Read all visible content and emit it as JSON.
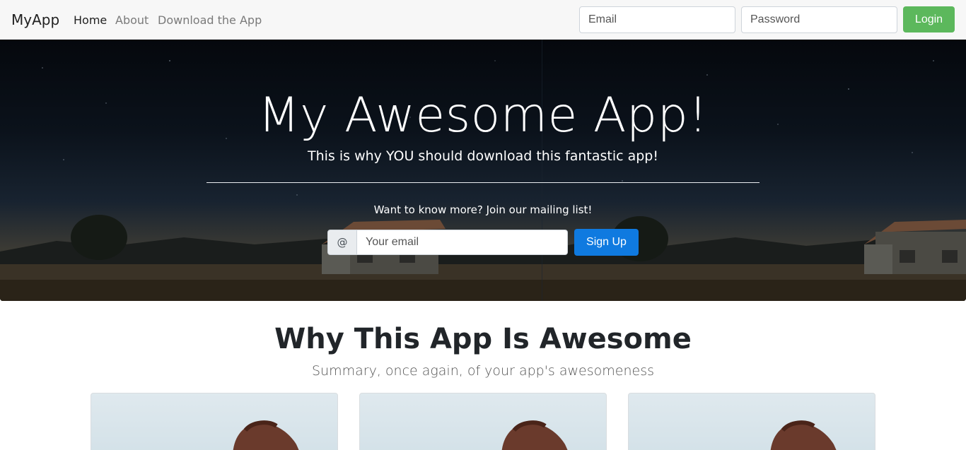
{
  "nav": {
    "brand": "MyApp",
    "links": [
      {
        "label": "Home",
        "active": true
      },
      {
        "label": "About",
        "active": false
      },
      {
        "label": "Download the App",
        "active": false
      }
    ],
    "email_placeholder": "Email",
    "password_placeholder": "Password",
    "login_label": "Login"
  },
  "hero": {
    "title": "My Awesome App!",
    "subtitle": "This is why YOU should download this fantastic app!",
    "mailing_text": "Want to know more? Join our mailing list!",
    "addon": "@",
    "email_placeholder": "Your email",
    "signup_label": "Sign Up"
  },
  "features": {
    "title": "Why This App Is Awesome",
    "subtitle": "Summary, once again, of your app's awesomeness",
    "cards": [
      {
        "image": "card-image"
      },
      {
        "image": "card-image"
      },
      {
        "image": "card-image"
      }
    ]
  },
  "colors": {
    "login": "#5cb85c",
    "signup": "#0f7ae0",
    "navbar": "#f7f7f7"
  }
}
